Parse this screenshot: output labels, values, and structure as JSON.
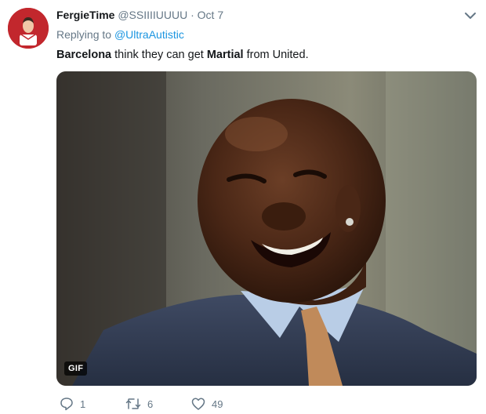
{
  "tweet": {
    "author": {
      "name": "FergieTime",
      "handle": "@SSIIIIUUUU",
      "date": "Oct 7"
    },
    "reply": {
      "prefix": "Replying to",
      "mention": "@UltraAutistic"
    },
    "text": {
      "part1": "Barcelona",
      "part2": " think they can get ",
      "part3": "Martial",
      "part4": " from United."
    },
    "media": {
      "badge": "GIF"
    },
    "actions": {
      "reply_count": "1",
      "retweet_count": "6",
      "like_count": "49"
    }
  },
  "colors": {
    "link": "#1b95e0",
    "secondary_text": "#657786",
    "avatar_bg": "#c2272d"
  },
  "icons": [
    "chevron-down-icon",
    "reply-icon",
    "retweet-icon",
    "heart-icon"
  ]
}
